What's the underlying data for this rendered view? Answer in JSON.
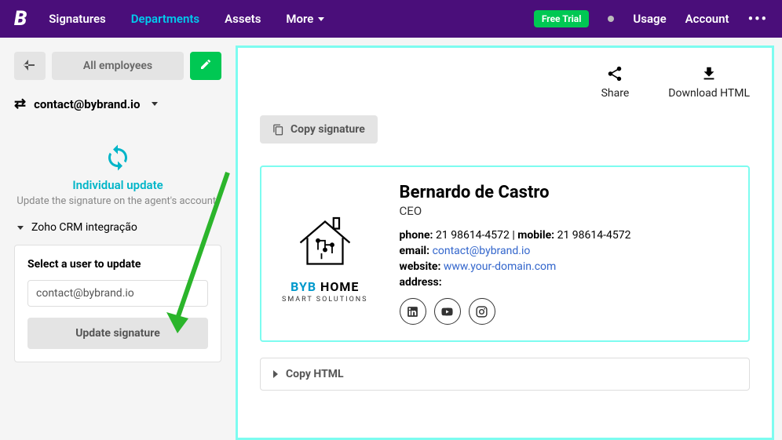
{
  "nav": {
    "items": [
      "Signatures",
      "Departments",
      "Assets"
    ],
    "more": "More",
    "free_trial": "Free Trial",
    "usage": "Usage",
    "account": "Account"
  },
  "sidebar": {
    "all_employees": "All employees",
    "email": "contact@bybrand.io",
    "individual_update_title": "Individual update",
    "individual_update_desc": "Update the signature on the agent's account.",
    "zoho_header": "Zoho CRM integração",
    "select_label": "Select a user to update",
    "user_value": "contact@bybrand.io",
    "update_btn": "Update signature"
  },
  "main": {
    "share": "Share",
    "download": "Download HTML",
    "copy_signature": "Copy signature",
    "copy_html": "Copy HTML"
  },
  "signature": {
    "name": "Bernardo de Castro",
    "title": "CEO",
    "phone_label": "phone:",
    "phone": "21 98614-4572",
    "mobile_label": "mobile:",
    "mobile": "21 98614-4572",
    "email_label": "email:",
    "email": "contact@bybrand.io",
    "website_label": "website:",
    "website": "www.your-domain.com",
    "address_label": "address:",
    "logo_line1_a": "BYB",
    "logo_line1_b": " HOME",
    "logo_line2": "SMART SOLUTIONS"
  }
}
